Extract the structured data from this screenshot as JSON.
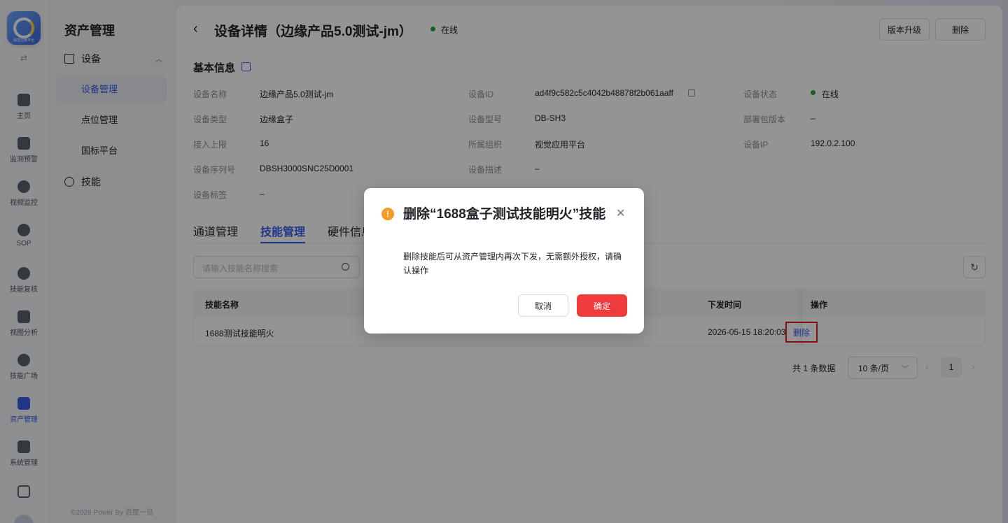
{
  "rail": {
    "logo_caption": "视觉应用平台",
    "toggle": "⇄",
    "items": [
      {
        "label": "主页",
        "icon": "home-icon"
      },
      {
        "label": "监测预警",
        "icon": "chart-icon"
      },
      {
        "label": "视频监控",
        "icon": "camera-icon"
      },
      {
        "label": "SOP",
        "icon": "sop-icon"
      },
      {
        "label": "技能复核",
        "icon": "review-icon"
      },
      {
        "label": "视图分析",
        "icon": "analysis-icon"
      },
      {
        "label": "技能广场",
        "icon": "skill-square-icon"
      },
      {
        "label": "资产管理",
        "icon": "asset-icon",
        "active": true
      },
      {
        "label": "系统管理",
        "icon": "system-icon"
      }
    ]
  },
  "side": {
    "title": "资产管理",
    "group_device": "设备",
    "sub_device_manage": "设备管理",
    "sub_point_manage": "点位管理",
    "sub_gb_platform": "国标平台",
    "group_skill": "技能",
    "footer": "©2026 Power By 百度一见"
  },
  "header": {
    "back": "‹",
    "title": "设备详情（边缘产品5.0测试-jm）",
    "status": "在线",
    "btn_upgrade": "版本升级",
    "btn_delete": "删除",
    "status_color": "#2ea043"
  },
  "basic": {
    "title": "基本信息",
    "fields": {
      "name_l": "设备名称",
      "name_v": "边缘产品5.0测试-jm",
      "id_l": "设备ID",
      "id_v": "ad4f9c582c5c4042b48878f2b061aaff",
      "state_l": "设备状态",
      "state_v": "在线",
      "type_l": "设备类型",
      "type_v": "边缘盒子",
      "model_l": "设备型号",
      "model_v": "DB-SH3",
      "pkg_l": "部署包版本",
      "pkg_v": "–",
      "limit_l": "接入上限",
      "limit_v": "16",
      "org_l": "所属组织",
      "org_v": "视觉应用平台",
      "ip_l": "设备IP",
      "ip_v": "192.0.2.100",
      "sn_l": "设备序列号",
      "sn_v": "DBSH3000SNC25D0001",
      "desc_l": "设备描述",
      "desc_v": "–",
      "tag_l": "设备标签",
      "tag_v": "–"
    }
  },
  "tabs": {
    "channel": "通道管理",
    "skill": "技能管理",
    "hardware": "硬件信息"
  },
  "search": {
    "placeholder": "请输入技能名称搜索"
  },
  "table": {
    "headers": {
      "name": "技能名称",
      "time": "下发时间",
      "op": "操作"
    },
    "rows": [
      {
        "name": "1688测试技能明火",
        "time": "2026-05-15 18:20:03",
        "op": "删除"
      }
    ]
  },
  "pagination": {
    "total": "共 1 条数据",
    "page_size": "10 条/页",
    "current": "1"
  },
  "modal": {
    "title": "删除“1688盒子测试技能明火”技能",
    "body": "删除技能后可从资产管理内再次下发，无需额外授权，请确认操作",
    "cancel": "取消",
    "confirm": "确定",
    "confirm_color": "#ef3b3b",
    "warn_color": "#f59a23"
  }
}
